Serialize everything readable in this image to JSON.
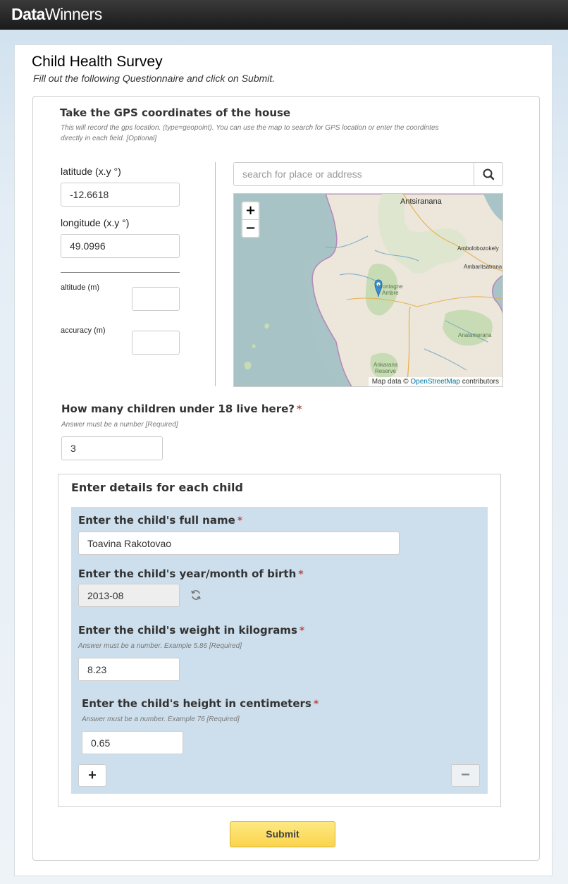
{
  "app": {
    "brand_bold": "Data",
    "brand_regular": "Winners"
  },
  "survey": {
    "title": "Child Health Survey",
    "subtitle": "Fill out the following Questionnaire and click on Submit."
  },
  "gps": {
    "question": "Take the GPS coordinates of the house",
    "hint_line1": "This will record the gps location. (type=geopoint). You can use the map to search for GPS location or enter the coordintes",
    "hint_line2": "directly in each field. [Optional]",
    "latitude_label": "latitude (x.y °)",
    "latitude_value": "-12.6618",
    "longitude_label": "longitude (x.y °)",
    "longitude_value": "49.0996",
    "altitude_label": "altitude (m)",
    "altitude_value": "",
    "accuracy_label": "accuracy (m)",
    "accuracy_value": "",
    "search_placeholder": "search for place or address",
    "map": {
      "zoom_in": "+",
      "zoom_out": "−",
      "attribution_prefix": "Map data ©",
      "attribution_link": "OpenStreetMap",
      "attribution_suffix": "contributors",
      "places": {
        "antsiranana": "Antsiranana",
        "ambolobozokely": "Ambolobozokely",
        "ambaritsatrana": "Ambaritsatrana",
        "montagne": "Montagne",
        "ambre": "Ambre",
        "analamerana": "Analamerana",
        "ankarana": "Ankarana",
        "reserve": "Reserve"
      }
    }
  },
  "children_count": {
    "question": "How many children under 18 live here?",
    "required_mark": "*",
    "hint": "Answer must be a number [Required]",
    "value": "3"
  },
  "child_details": {
    "title": "Enter details for each child",
    "name_label": "Enter the child's full name",
    "name_value": "Toavina Rakotovao",
    "birth_label": "Enter the child's year/month of birth",
    "birth_value": "2013-08",
    "weight_label": "Enter the child's weight in kilograms",
    "weight_hint": "Answer must be a number. Example 5.86 [Required]",
    "weight_value": "8.23",
    "height_label": "Enter the child's height in centimeters",
    "height_hint": "Answer must be a number. Example 76 [Required]",
    "height_value": "0.65",
    "required_mark": "*",
    "add_label": "+",
    "remove_label": "−"
  },
  "submit_label": "Submit",
  "colors": {
    "required": "#b94a48",
    "group_bg": "#cddfec",
    "submit": "#fbd44c",
    "marker": "#3d8fd1"
  }
}
